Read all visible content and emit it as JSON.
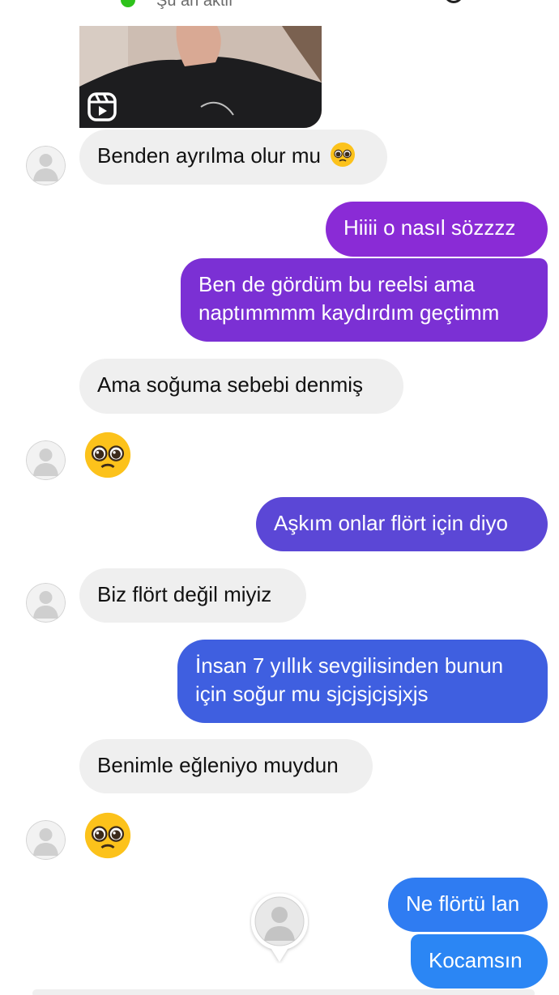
{
  "header": {
    "status": "Şu an aktif",
    "online_color": "#2ec21b"
  },
  "shared_reel": {
    "icon": "reels-icon"
  },
  "messages": [
    {
      "side": "in",
      "text": "Benden ayrılma olur mu",
      "emoji": "pleading-face"
    },
    {
      "side": "out",
      "text": "Hiiii o nasıl sözzzz",
      "color": "#8a2bd6"
    },
    {
      "side": "out",
      "lines": [
        "Ben de gördüm bu reelsi ama",
        "naptımmmm kaydırdım geçtimm"
      ],
      "color": "#7b30d4"
    },
    {
      "side": "in",
      "text": "Ama soğuma sebebi denmiş"
    },
    {
      "side": "in",
      "emoji_only": "pleading-face"
    },
    {
      "side": "out",
      "text": "Aşkım onlar flört için diyo",
      "color": "#5b47d6"
    },
    {
      "side": "in",
      "text": "Biz flört değil miyiz"
    },
    {
      "side": "out",
      "lines": [
        "İnsan 7 yıllık sevgilisinden bunun",
        "için soğur mu sjcjsjcjsjxjs"
      ],
      "color": "#3f5fe0"
    },
    {
      "side": "in",
      "text": "Benimle eğleniyo muydun"
    },
    {
      "side": "in",
      "emoji_only": "pleading-face"
    },
    {
      "side": "out",
      "text": "Ne flörtü lan",
      "color": "#2f7cf2"
    },
    {
      "side": "out",
      "text": "Kocamsın",
      "color": "#2b86f4"
    }
  ],
  "seen_avatar": {
    "icon": "profile-placeholder-icon"
  }
}
